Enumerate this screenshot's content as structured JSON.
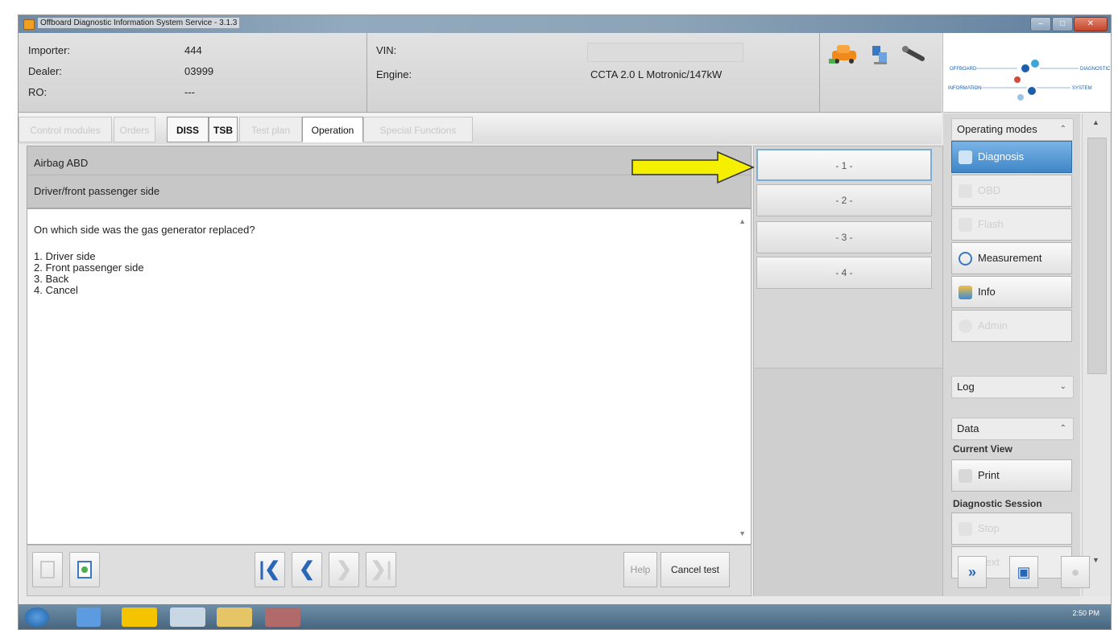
{
  "window": {
    "title": "Offboard Diagnostic Information System Service - 3.1.3"
  },
  "header": {
    "importer_label": "Importer:",
    "importer_value": "444",
    "dealer_label": "Dealer:",
    "dealer_value": "03999",
    "ro_label": "RO:",
    "ro_value": "---",
    "vin_label": "VIN:",
    "vin_value": "",
    "engine_label": "Engine:",
    "engine_value": "CCTA 2.0 L Motronic/147kW"
  },
  "tabs": [
    {
      "label": "Control modules"
    },
    {
      "label": "Orders"
    },
    {
      "label": "DISS"
    },
    {
      "label": "TSB"
    },
    {
      "label": "Test plan"
    },
    {
      "label": "Operation"
    },
    {
      "label": "Special Functions"
    }
  ],
  "question": {
    "title": "Airbag ABD",
    "subtitle": "Driver/front passenger side",
    "text": "On which side was the gas generator replaced?",
    "options": [
      "1. Driver side",
      "2. Front passenger side",
      "3. Back",
      "4. Cancel"
    ]
  },
  "answers": [
    "- 1 -",
    "- 2 -",
    "- 3 -",
    "- 4 -"
  ],
  "bottom": {
    "help": "Help",
    "cancel_test": "Cancel test"
  },
  "sidebar": {
    "operating_modes": "Operating modes",
    "modes": [
      {
        "label": "Diagnosis",
        "state": "active"
      },
      {
        "label": "OBD",
        "state": "disabled"
      },
      {
        "label": "Flash",
        "state": "disabled"
      },
      {
        "label": "Measurement",
        "state": "enabled"
      },
      {
        "label": "Info",
        "state": "enabled"
      },
      {
        "label": "Admin",
        "state": "disabled"
      }
    ],
    "log": "Log",
    "data": "Data",
    "current_view": "Current View",
    "print": "Print",
    "diagnostic_session": "Diagnostic Session",
    "stop": "Stop",
    "next": "Next"
  },
  "taskbar": {
    "clock": "2:50 PM"
  },
  "colors": {
    "accent": "#3f86c8",
    "arrow": "#f5f000"
  }
}
